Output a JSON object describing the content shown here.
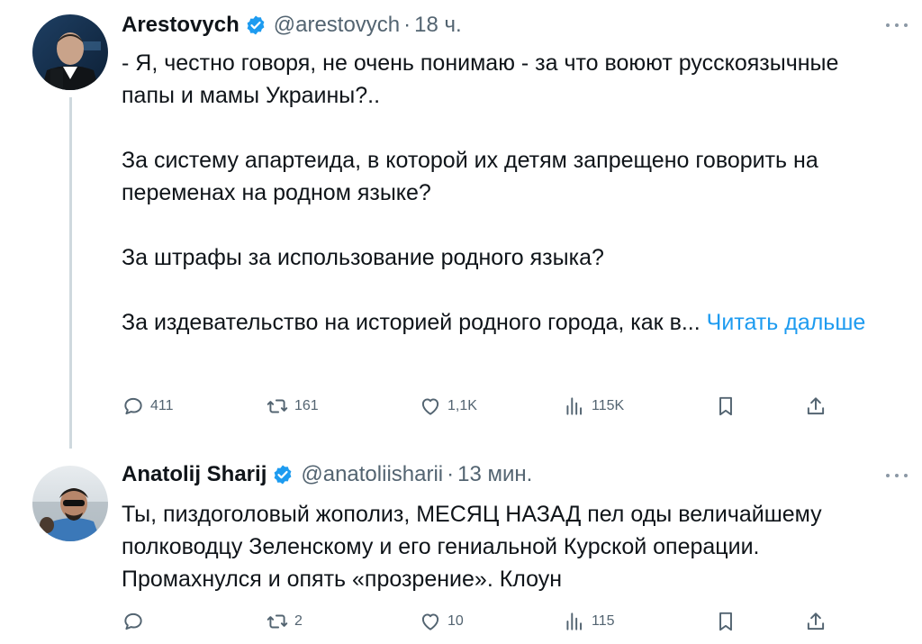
{
  "colors": {
    "link": "#1d9bf0",
    "verified": "#1d9bf0",
    "muted": "#536471",
    "text": "#0f1419"
  },
  "tweets": [
    {
      "display_name": "Arestovych",
      "handle": "@arestovych",
      "separator": "·",
      "time": "18 ч.",
      "paragraphs": [
        "- Я, честно говоря, не очень понимаю - за что воюют русскоязычные папы и мамы Украины?..",
        "За систему апартеида, в которой их детям запрещено говорить на переменах на родном языке?",
        "За штрафы за использование родного языка?",
        "За издевательство на историей родного города, как в..."
      ],
      "read_more": "Читать дальше",
      "stats": {
        "replies": "411",
        "retweets": "161",
        "likes": "1,1K",
        "views": "115K"
      }
    },
    {
      "display_name": "Anatolij Sharij",
      "handle": "@anatoliisharii",
      "separator": "·",
      "time": "13 мин.",
      "paragraphs": [
        "Ты, пиздоголовый жополиз, МЕСЯЦ НАЗАД пел оды величайшему полководцу Зеленскому и его гениальной Курской операции. Промахнулся и опять «прозрение». Клоун"
      ],
      "stats": {
        "replies": "",
        "retweets": "2",
        "likes": "10",
        "views": "115"
      }
    }
  ]
}
